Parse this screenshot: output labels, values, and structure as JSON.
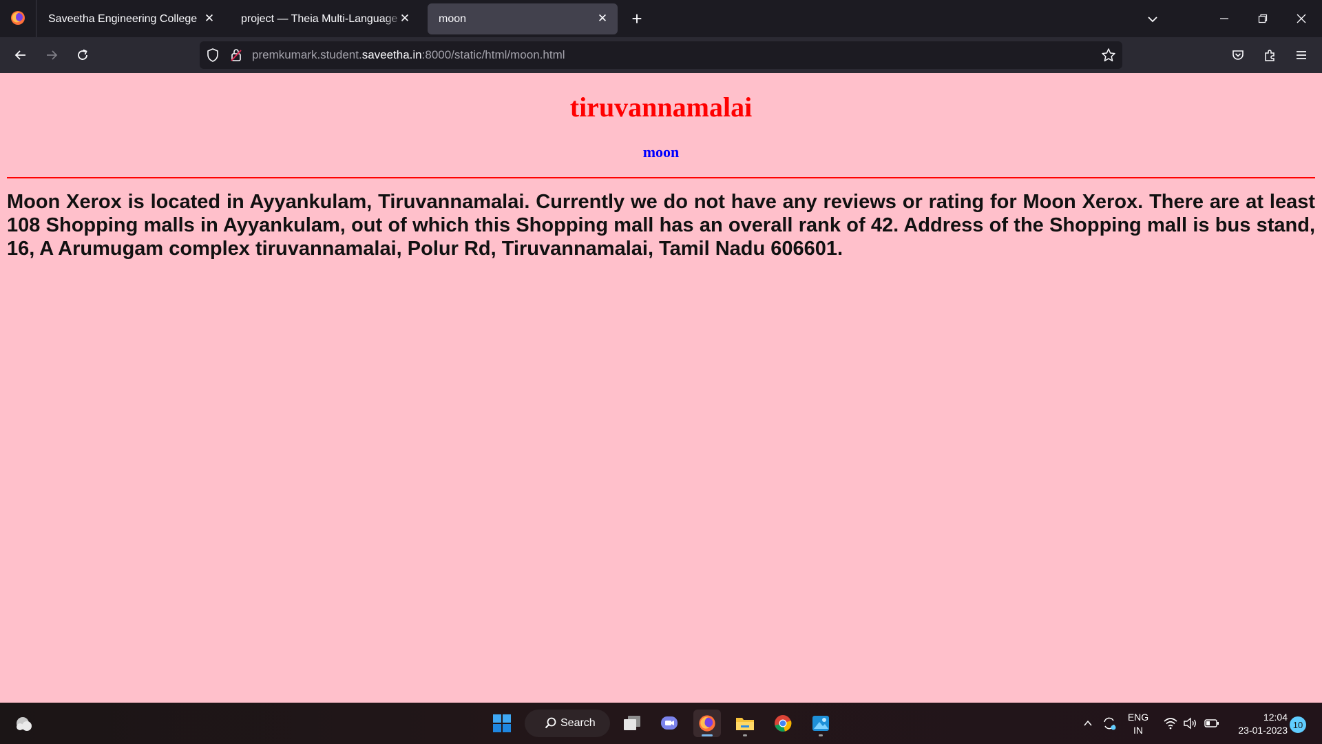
{
  "browser": {
    "tabs": [
      {
        "label": "Saveetha Engineering College",
        "active": false
      },
      {
        "label": "project — Theia Multi-Language Explorer",
        "active": false
      },
      {
        "label": "moon",
        "active": true
      }
    ],
    "url": {
      "prefix": "premkumark.student.",
      "host": "saveetha.in",
      "suffix": ":8000/static/html/moon.html"
    }
  },
  "page": {
    "heading": "tiruvannamalai",
    "subheading": "moon",
    "body": "Moon Xerox is located in Ayyankulam, Tiruvannamalai. Currently we do not have any reviews or rating for Moon Xerox. There are at least 108 Shopping malls in Ayyankulam, out of which this Shopping mall has an overall rank of 42. Address of the Shopping mall is bus stand, 16, A Arumugam complex tiruvannamalai, Polur Rd, Tiruvannamalai, Tamil Nadu 606601.",
    "colors": {
      "background": "#ffc0cb",
      "heading": "#ff0000",
      "subheading": "#0000ff",
      "rule": "#ff0000"
    }
  },
  "taskbar": {
    "search_label": "Search",
    "language": {
      "line1": "ENG",
      "line2": "IN"
    },
    "time": "12:04",
    "date": "23-01-2023",
    "notification_count": "10",
    "apps": [
      "start-icon",
      "task-view-icon",
      "teams-chat-icon",
      "firefox-icon",
      "file-explorer-icon",
      "chrome-icon",
      "photos-icon"
    ]
  }
}
